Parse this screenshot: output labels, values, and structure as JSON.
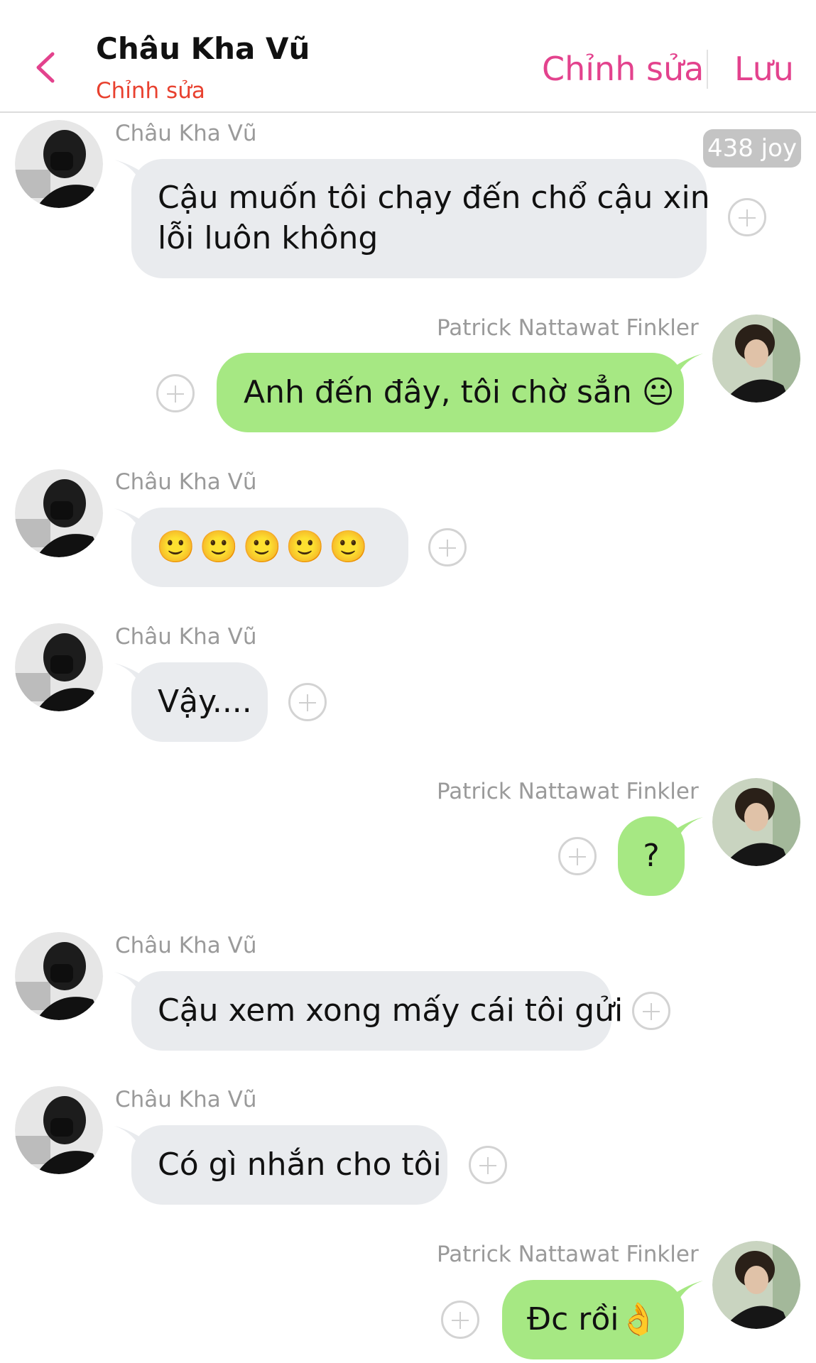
{
  "header": {
    "title": "Châu Kha Vũ",
    "subtitle": "Chỉnh sửa",
    "edit_label": "Chỉnh sửa",
    "save_label": "Lưu"
  },
  "badge": "438 joy",
  "messages": [
    {
      "side": "left",
      "name": "Châu Kha Vũ",
      "text_line1": "Cậu muốn tôi chạy đến chổ cậu xin",
      "text_line2": "lỗi  luôn không"
    },
    {
      "side": "right",
      "name": "Patrick Nattawat Finkler",
      "text": "Anh đến đây, tôi chờ sẳn 😐"
    },
    {
      "side": "left",
      "name": "Châu Kha Vũ",
      "text": "🙂🙂🙂🙂🙂"
    },
    {
      "side": "left",
      "name": "Châu Kha Vũ",
      "text": "Vậy...."
    },
    {
      "side": "right",
      "name": "Patrick Nattawat Finkler",
      "text": "?"
    },
    {
      "side": "left",
      "name": "Châu Kha Vũ",
      "text": "Cậu xem xong mấy cái tôi gửi"
    },
    {
      "side": "left",
      "name": "Châu Kha Vũ",
      "text": "Có gì nhắn cho tôi"
    },
    {
      "side": "right",
      "name": "Patrick Nattawat Finkler",
      "text": "Đc rồi👌"
    }
  ]
}
